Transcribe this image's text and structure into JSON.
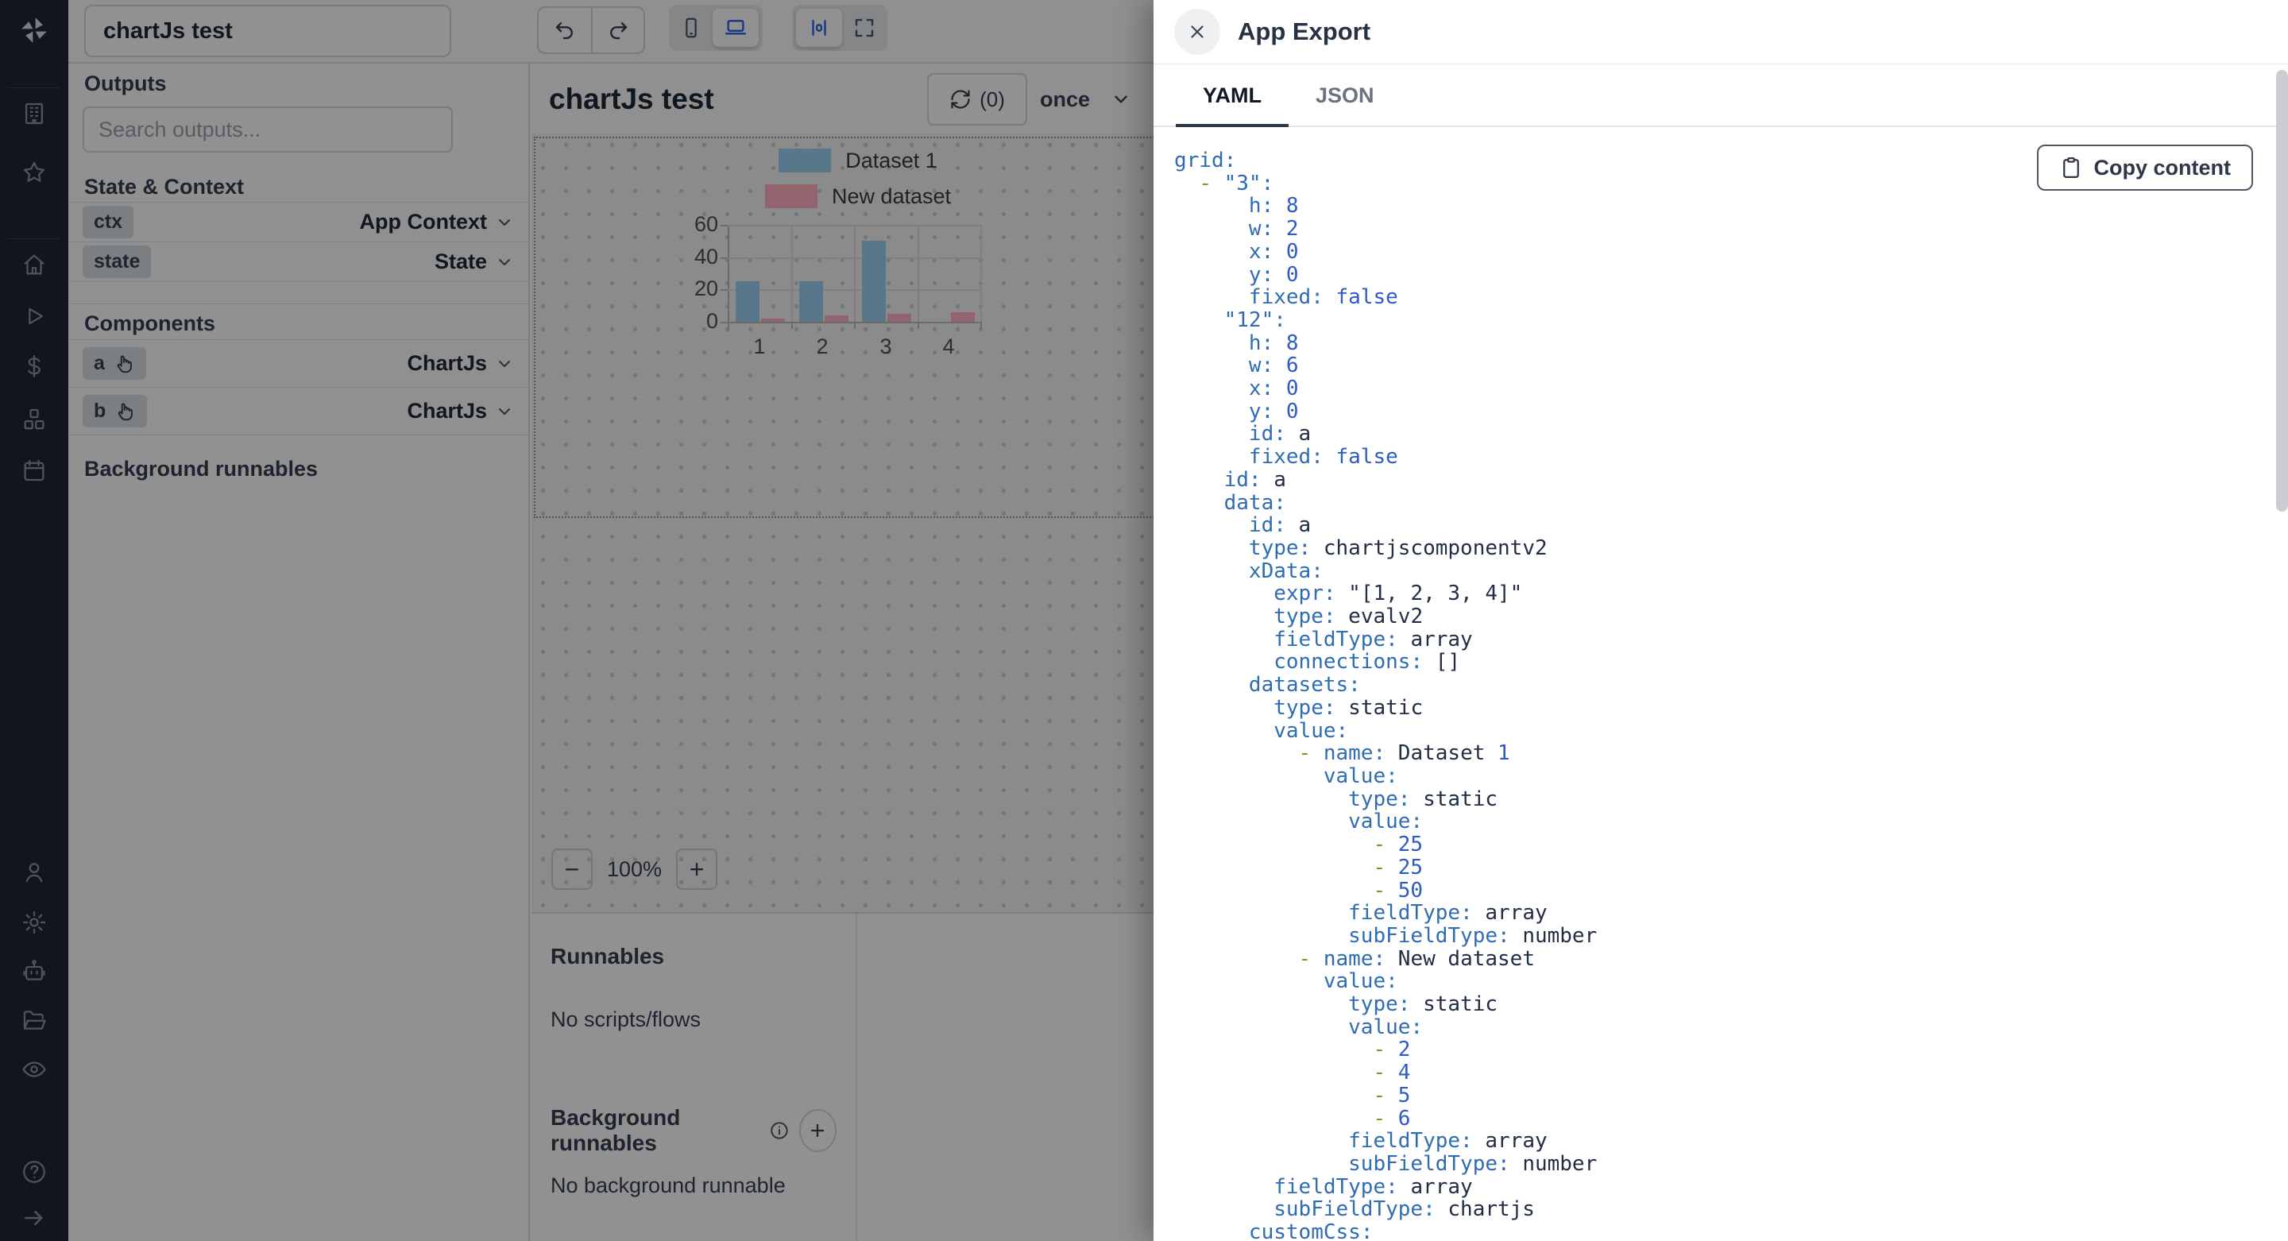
{
  "colors": {
    "accent_blue": "#2563eb",
    "sidebar_bg": "#1e2736",
    "overlay": "rgba(0,0,0,0.43)",
    "code_key": "#2f6cb3",
    "code_number": "#2c5bc6",
    "code_string": "#212e44",
    "code_dash": "#96891f"
  },
  "sidebar": {
    "icons": [
      "windmill-logo",
      "building-icon",
      "star-icon",
      "home-icon",
      "play-icon",
      "dollar-icon",
      "cubes-icon",
      "calendar-icon",
      "user-icon",
      "gear-icon",
      "robot-icon",
      "folder-icon",
      "eye-icon",
      "help-icon",
      "arrow-right-icon"
    ]
  },
  "topbar": {
    "title_value": "chartJs test"
  },
  "outputs_panel": {
    "title": "Outputs",
    "search_placeholder": "Search outputs...",
    "state_context_header": "State & Context",
    "rows": [
      {
        "badge": "ctx",
        "type": "App Context"
      },
      {
        "badge": "state",
        "type": "State"
      }
    ],
    "components_header": "Components",
    "component_rows": [
      {
        "badge": "a",
        "type": "ChartJs"
      },
      {
        "badge": "b",
        "type": "ChartJs"
      }
    ],
    "background_header": "Background runnables"
  },
  "canvas": {
    "title": "chartJs test",
    "refresh_count": "(0)",
    "schedule": "once",
    "zoom_out": "−",
    "zoom_level": "100%",
    "zoom_in": "+"
  },
  "runnables_panel": {
    "title": "Runnables",
    "empty": "No scripts/flows",
    "background_title": "Background runnables",
    "background_empty": "No background runnable"
  },
  "modal": {
    "title": "App Export",
    "tabs": [
      {
        "label": "YAML"
      },
      {
        "label": "JSON"
      }
    ],
    "copy_button": "Copy content",
    "code_lines": [
      [
        [
          "k",
          "grid:"
        ]
      ],
      [
        [
          "w",
          "  "
        ],
        [
          "d",
          "-"
        ],
        [
          "w",
          " "
        ],
        [
          "k",
          "\"3\":"
        ]
      ],
      [
        [
          "w",
          "      "
        ],
        [
          "k",
          "h:"
        ],
        [
          "w",
          " "
        ],
        [
          "n",
          "8"
        ]
      ],
      [
        [
          "w",
          "      "
        ],
        [
          "k",
          "w:"
        ],
        [
          "w",
          " "
        ],
        [
          "n",
          "2"
        ]
      ],
      [
        [
          "w",
          "      "
        ],
        [
          "k",
          "x:"
        ],
        [
          "w",
          " "
        ],
        [
          "n",
          "0"
        ]
      ],
      [
        [
          "w",
          "      "
        ],
        [
          "k",
          "y:"
        ],
        [
          "w",
          " "
        ],
        [
          "n",
          "0"
        ]
      ],
      [
        [
          "w",
          "      "
        ],
        [
          "k",
          "fixed:"
        ],
        [
          "w",
          " "
        ],
        [
          "n",
          "false"
        ]
      ],
      [
        [
          "w",
          "    "
        ],
        [
          "k",
          "\"12\":"
        ]
      ],
      [
        [
          "w",
          "      "
        ],
        [
          "k",
          "h:"
        ],
        [
          "w",
          " "
        ],
        [
          "n",
          "8"
        ]
      ],
      [
        [
          "w",
          "      "
        ],
        [
          "k",
          "w:"
        ],
        [
          "w",
          " "
        ],
        [
          "n",
          "6"
        ]
      ],
      [
        [
          "w",
          "      "
        ],
        [
          "k",
          "x:"
        ],
        [
          "w",
          " "
        ],
        [
          "n",
          "0"
        ]
      ],
      [
        [
          "w",
          "      "
        ],
        [
          "k",
          "y:"
        ],
        [
          "w",
          " "
        ],
        [
          "n",
          "0"
        ]
      ],
      [
        [
          "w",
          "      "
        ],
        [
          "k",
          "id:"
        ],
        [
          "w",
          " "
        ],
        [
          "s",
          "a"
        ]
      ],
      [
        [
          "w",
          "      "
        ],
        [
          "k",
          "fixed:"
        ],
        [
          "w",
          " "
        ],
        [
          "n",
          "false"
        ]
      ],
      [
        [
          "w",
          "    "
        ],
        [
          "k",
          "id:"
        ],
        [
          "w",
          " "
        ],
        [
          "s",
          "a"
        ]
      ],
      [
        [
          "w",
          "    "
        ],
        [
          "k",
          "data:"
        ]
      ],
      [
        [
          "w",
          "      "
        ],
        [
          "k",
          "id:"
        ],
        [
          "w",
          " "
        ],
        [
          "s",
          "a"
        ]
      ],
      [
        [
          "w",
          "      "
        ],
        [
          "k",
          "type:"
        ],
        [
          "w",
          " "
        ],
        [
          "s",
          "chartjscomponentv2"
        ]
      ],
      [
        [
          "w",
          "      "
        ],
        [
          "k",
          "xData:"
        ]
      ],
      [
        [
          "w",
          "        "
        ],
        [
          "k",
          "expr:"
        ],
        [
          "w",
          " "
        ],
        [
          "s",
          "\"[1, 2, 3, 4]\""
        ]
      ],
      [
        [
          "w",
          "        "
        ],
        [
          "k",
          "type:"
        ],
        [
          "w",
          " "
        ],
        [
          "s",
          "evalv2"
        ]
      ],
      [
        [
          "w",
          "        "
        ],
        [
          "k",
          "fieldType:"
        ],
        [
          "w",
          " "
        ],
        [
          "s",
          "array"
        ]
      ],
      [
        [
          "w",
          "        "
        ],
        [
          "k",
          "connections:"
        ],
        [
          "w",
          " "
        ],
        [
          "s",
          "[]"
        ]
      ],
      [
        [
          "w",
          "      "
        ],
        [
          "k",
          "datasets:"
        ]
      ],
      [
        [
          "w",
          "        "
        ],
        [
          "k",
          "type:"
        ],
        [
          "w",
          " "
        ],
        [
          "s",
          "static"
        ]
      ],
      [
        [
          "w",
          "        "
        ],
        [
          "k",
          "value:"
        ]
      ],
      [
        [
          "w",
          "          "
        ],
        [
          "d",
          "-"
        ],
        [
          "w",
          " "
        ],
        [
          "k",
          "name:"
        ],
        [
          "w",
          " "
        ],
        [
          "s",
          "Dataset"
        ],
        [
          "w",
          " "
        ],
        [
          "n",
          "1"
        ]
      ],
      [
        [
          "w",
          "            "
        ],
        [
          "k",
          "value:"
        ]
      ],
      [
        [
          "w",
          "              "
        ],
        [
          "k",
          "type:"
        ],
        [
          "w",
          " "
        ],
        [
          "s",
          "static"
        ]
      ],
      [
        [
          "w",
          "              "
        ],
        [
          "k",
          "value:"
        ]
      ],
      [
        [
          "w",
          "                "
        ],
        [
          "d",
          "-"
        ],
        [
          "w",
          " "
        ],
        [
          "n",
          "25"
        ]
      ],
      [
        [
          "w",
          "                "
        ],
        [
          "d",
          "-"
        ],
        [
          "w",
          " "
        ],
        [
          "n",
          "25"
        ]
      ],
      [
        [
          "w",
          "                "
        ],
        [
          "d",
          "-"
        ],
        [
          "w",
          " "
        ],
        [
          "n",
          "50"
        ]
      ],
      [
        [
          "w",
          "              "
        ],
        [
          "k",
          "fieldType:"
        ],
        [
          "w",
          " "
        ],
        [
          "s",
          "array"
        ]
      ],
      [
        [
          "w",
          "              "
        ],
        [
          "k",
          "subFieldType:"
        ],
        [
          "w",
          " "
        ],
        [
          "s",
          "number"
        ]
      ],
      [
        [
          "w",
          "          "
        ],
        [
          "d",
          "-"
        ],
        [
          "w",
          " "
        ],
        [
          "k",
          "name:"
        ],
        [
          "w",
          " "
        ],
        [
          "s",
          "New dataset"
        ]
      ],
      [
        [
          "w",
          "            "
        ],
        [
          "k",
          "value:"
        ]
      ],
      [
        [
          "w",
          "              "
        ],
        [
          "k",
          "type:"
        ],
        [
          "w",
          " "
        ],
        [
          "s",
          "static"
        ]
      ],
      [
        [
          "w",
          "              "
        ],
        [
          "k",
          "value:"
        ]
      ],
      [
        [
          "w",
          "                "
        ],
        [
          "d",
          "-"
        ],
        [
          "w",
          " "
        ],
        [
          "n",
          "2"
        ]
      ],
      [
        [
          "w",
          "                "
        ],
        [
          "d",
          "-"
        ],
        [
          "w",
          " "
        ],
        [
          "n",
          "4"
        ]
      ],
      [
        [
          "w",
          "                "
        ],
        [
          "d",
          "-"
        ],
        [
          "w",
          " "
        ],
        [
          "n",
          "5"
        ]
      ],
      [
        [
          "w",
          "                "
        ],
        [
          "d",
          "-"
        ],
        [
          "w",
          " "
        ],
        [
          "n",
          "6"
        ]
      ],
      [
        [
          "w",
          "              "
        ],
        [
          "k",
          "fieldType:"
        ],
        [
          "w",
          " "
        ],
        [
          "s",
          "array"
        ]
      ],
      [
        [
          "w",
          "              "
        ],
        [
          "k",
          "subFieldType:"
        ],
        [
          "w",
          " "
        ],
        [
          "s",
          "number"
        ]
      ],
      [
        [
          "w",
          "        "
        ],
        [
          "k",
          "fieldType:"
        ],
        [
          "w",
          " "
        ],
        [
          "s",
          "array"
        ]
      ],
      [
        [
          "w",
          "        "
        ],
        [
          "k",
          "subFieldType:"
        ],
        [
          "w",
          " "
        ],
        [
          "s",
          "chartjs"
        ]
      ],
      [
        [
          "w",
          "      "
        ],
        [
          "k",
          "customCss:"
        ]
      ]
    ]
  },
  "chart_data": {
    "type": "bar",
    "categories": [
      "1",
      "2",
      "3",
      "4"
    ],
    "series": [
      {
        "name": "Dataset 1",
        "color": "#9bd1f5",
        "values": [
          25,
          25,
          50,
          null
        ]
      },
      {
        "name": "New dataset",
        "color": "#ffb1c1",
        "values": [
          2,
          4,
          5,
          6
        ]
      }
    ],
    "ylim": [
      0,
      60
    ],
    "yticks": [
      0,
      20,
      40,
      60
    ],
    "legend_position": "top",
    "grid": true
  }
}
